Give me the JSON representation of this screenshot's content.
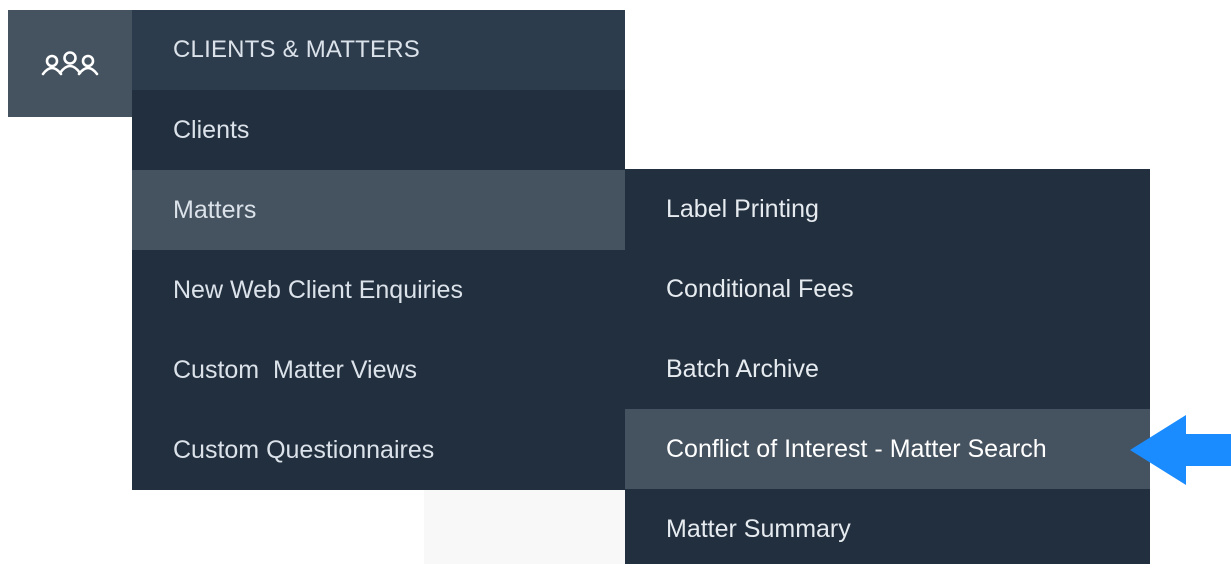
{
  "nav": {
    "icon": "users-icon",
    "header": "CLIENTS & MATTERS",
    "items": [
      {
        "label": "Clients"
      },
      {
        "label": "Matters"
      },
      {
        "label": "New Web Client Enquiries"
      },
      {
        "label": "Custom  Matter Views"
      },
      {
        "label": "Custom Questionnaires"
      }
    ]
  },
  "submenu": {
    "parent": "Matters",
    "items": [
      {
        "label": "Label Printing"
      },
      {
        "label": "Conditional Fees"
      },
      {
        "label": "Batch Archive"
      },
      {
        "label": "Conflict of Interest - Matter Search"
      },
      {
        "label": "Matter Summary"
      }
    ]
  },
  "annotation": {
    "icon": "arrow-left-icon",
    "color": "#1a8cff",
    "points_to": "Conflict of Interest - Matter Search"
  },
  "colors": {
    "menu_bg": "#222f3e",
    "header_bg": "#2d3c4d",
    "active_bg": "#45525f",
    "text": "#dbe2ea"
  }
}
